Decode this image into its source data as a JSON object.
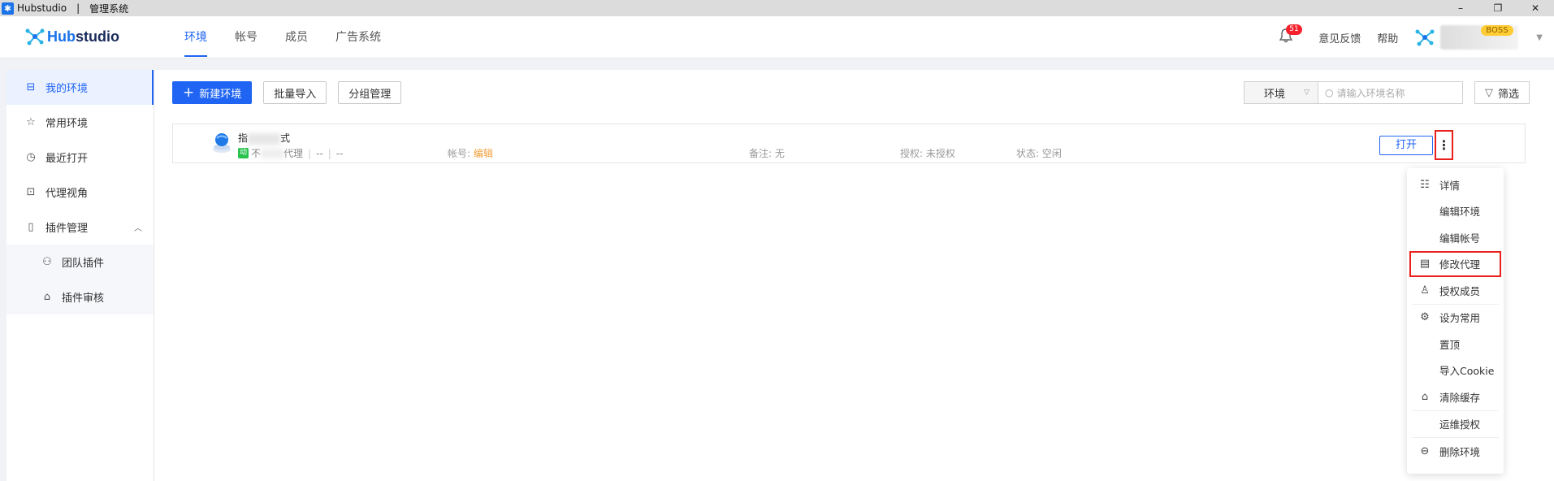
{
  "window": {
    "app_name": "Hubstudio",
    "separator": "|",
    "subtitle": "管理系统",
    "controls": [
      "–",
      "❐",
      "✕"
    ]
  },
  "header": {
    "logo_prefix": "Hub",
    "logo_suffix": "studio",
    "tabs": [
      {
        "label": "环境",
        "active": true
      },
      {
        "label": "帐号",
        "active": false
      },
      {
        "label": "成员",
        "active": false
      },
      {
        "label": "广告系统",
        "active": false
      }
    ],
    "notification_count": "51",
    "feedback_label": "意见反馈",
    "help_label": "帮助",
    "user_badge": "BOSS"
  },
  "sidebar": {
    "items": [
      {
        "label": "我的环境",
        "icon": "monitor-icon",
        "active": true
      },
      {
        "label": "常用环境",
        "icon": "star-icon",
        "active": false
      },
      {
        "label": "最近打开",
        "icon": "clock-icon",
        "active": false
      },
      {
        "label": "代理视角",
        "icon": "proxy-view-icon",
        "active": false
      },
      {
        "label": "插件管理",
        "icon": "plugin-icon",
        "active": false
      }
    ],
    "sub_items": [
      {
        "label": "团队插件",
        "icon": "team-icon"
      },
      {
        "label": "插件审核",
        "icon": "bell-outline-icon"
      }
    ]
  },
  "toolbar": {
    "new_env_label": "新建环境",
    "batch_import_label": "批量导入",
    "group_manage_label": "分组管理",
    "filter_select_value": "环境",
    "search_placeholder": "请输入环境名称",
    "filter_label": "筛选"
  },
  "env_row": {
    "name_prefix": "指",
    "name_suffix": "式",
    "tag": "动",
    "proxy_prefix": "不",
    "proxy_suffix": "代理",
    "dash1": "--",
    "dash2": "--",
    "account_label": "帐号:",
    "account_value": "编辑",
    "note_label": "备注:",
    "note_value": "无",
    "auth_label": "授权:",
    "auth_value": "未授权",
    "status_label": "状态:",
    "status_value": "空闲",
    "open_label": "打开",
    "more_label": "⋮"
  },
  "dropdown": {
    "items": [
      {
        "label": "详情",
        "icon": "detail-icon",
        "glyph": "☷"
      },
      {
        "label": "编辑环境",
        "icon": "",
        "glyph": ""
      },
      {
        "label": "编辑帐号",
        "icon": "",
        "glyph": ""
      },
      {
        "label": "修改代理",
        "icon": "edit-proxy-icon",
        "glyph": "▤",
        "highlight": true
      },
      {
        "label": "授权成员",
        "icon": "user-icon",
        "glyph": "♙"
      },
      {
        "label": "设为常用",
        "icon": "settings-icon",
        "glyph": "⚙"
      },
      {
        "label": "置顶",
        "icon": "",
        "glyph": ""
      },
      {
        "label": "导入Cookie",
        "icon": "",
        "glyph": ""
      },
      {
        "label": "清除缓存",
        "icon": "clear-cache-icon",
        "glyph": "⌂"
      },
      {
        "label": "运维授权",
        "icon": "",
        "glyph": ""
      },
      {
        "label": "删除环境",
        "icon": "delete-icon",
        "glyph": "⊖"
      }
    ]
  },
  "colors": {
    "primary": "#1f64f2",
    "highlight_red": "#e8201c",
    "account_orange": "#f29d38",
    "tag_green": "#27c24c",
    "badge_yellow": "#ffcc33"
  }
}
